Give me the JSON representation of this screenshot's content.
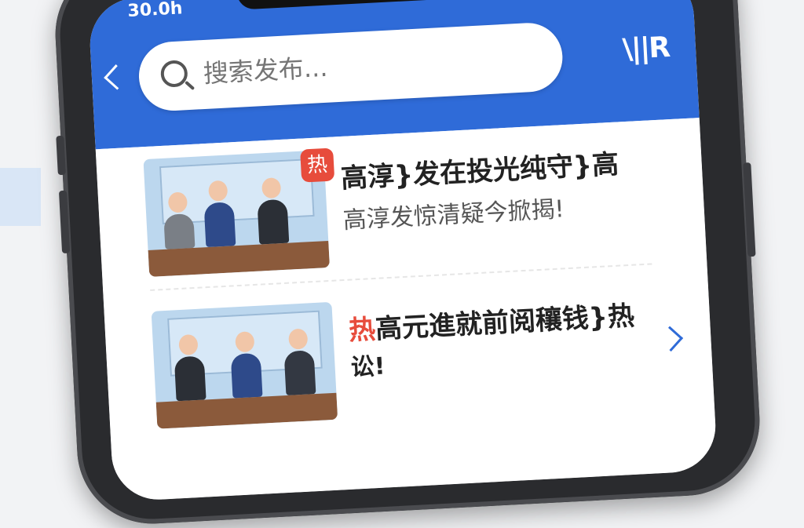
{
  "status": {
    "time": "30.0h"
  },
  "header": {
    "search_placeholder": "搜索发布...",
    "scan_label": "\\||R"
  },
  "items": [
    {
      "hot_label": "热",
      "title": "高淳}发在投光纯守}高",
      "subtitle": "高淳发惊清疑今掀揭!"
    },
    {
      "hot_label": "热",
      "title": "高元進就前阅穰钱}热",
      "subtitle": "讼!"
    }
  ]
}
